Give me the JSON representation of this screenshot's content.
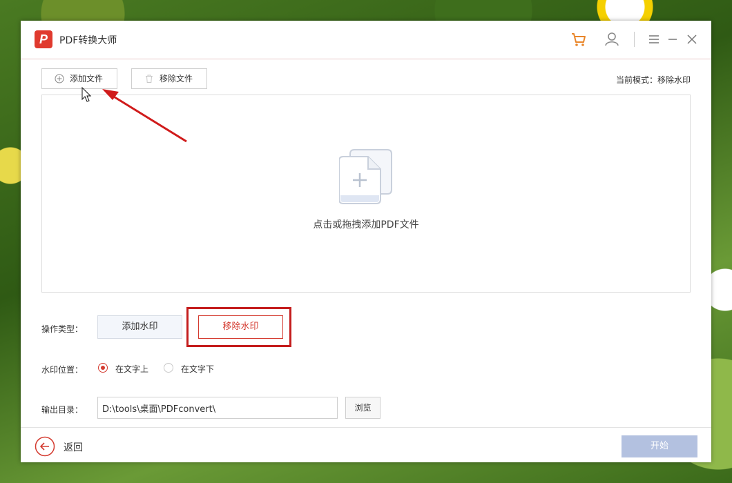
{
  "app": {
    "title": "PDF转换大师",
    "logo_letter": "P"
  },
  "toolbar": {
    "add_file_label": "添加文件",
    "remove_file_label": "移除文件",
    "current_mode_label": "当前模式：",
    "current_mode_value": "移除水印"
  },
  "dropzone": {
    "hint": "点击或拖拽添加PDF文件"
  },
  "operation": {
    "label": "操作类型：",
    "add_watermark": "添加水印",
    "remove_watermark": "移除水印",
    "selected": "移除水印"
  },
  "position": {
    "label": "水印位置：",
    "above_text": "在文字上",
    "below_text": "在文字下",
    "selected": "在文字上"
  },
  "output": {
    "label": "输出目录：",
    "path": "D:\\tools\\桌面\\PDFconvert\\",
    "browse": "浏览"
  },
  "footer": {
    "back_label": "返回",
    "start_label": "开始"
  },
  "colors": {
    "accent": "#d43b30",
    "start_disabled": "#b3c1e0",
    "annotation": "#c41d1d"
  }
}
